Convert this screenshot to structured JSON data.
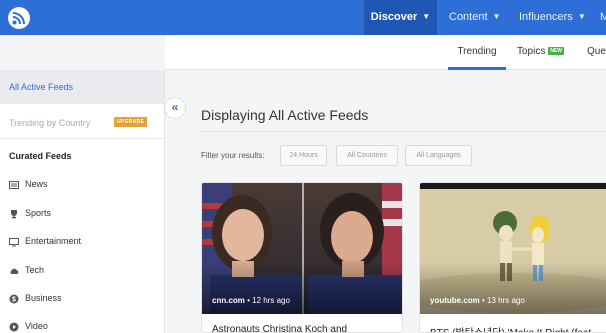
{
  "topbar": {
    "logo_icon": "rss-logo-icon",
    "nav": [
      {
        "label": "Discover"
      },
      {
        "label": "Content"
      },
      {
        "label": "Influencers"
      },
      {
        "label": "M"
      }
    ]
  },
  "subnav": {
    "tabs": [
      {
        "label": "Trending"
      },
      {
        "label": "Topics",
        "badge": "NEW"
      },
      {
        "label": "Ques"
      }
    ]
  },
  "sidebar": {
    "all_active": "All Active Feeds",
    "trending_country": "Trending by Country",
    "upgrade_badge": "UPGRADE",
    "curated_heading": "Curated Feeds",
    "categories": [
      {
        "label": "News",
        "icon": "newspaper-icon"
      },
      {
        "label": "Sports",
        "icon": "trophy-icon"
      },
      {
        "label": "Entertainment",
        "icon": "tv-icon"
      },
      {
        "label": "Tech",
        "icon": "cloud-icon"
      },
      {
        "label": "Business",
        "icon": "dollar-icon"
      },
      {
        "label": "Video",
        "icon": "play-icon"
      }
    ]
  },
  "main": {
    "title": "Displaying All Active Feeds",
    "filter_label": "Filter your results:",
    "filters": [
      "24 Hours",
      "All Countries",
      "All Languages"
    ],
    "collapse_icon": "double-chevron-left-icon"
  },
  "cards": [
    {
      "source": "cnn.com",
      "time": " • 12 hrs ago",
      "title": "Astronauts Christina Koch and"
    },
    {
      "source": "youtube.com",
      "time": " • 13 hrs ago",
      "title": "BTS (방탄소년단) 'Make It Right (feat."
    }
  ],
  "colors": {
    "brand_blue": "#2d6fd6",
    "active_nav": "#1f57b5",
    "upgrade": "#e1a33a",
    "new_badge": "#46b04a"
  }
}
